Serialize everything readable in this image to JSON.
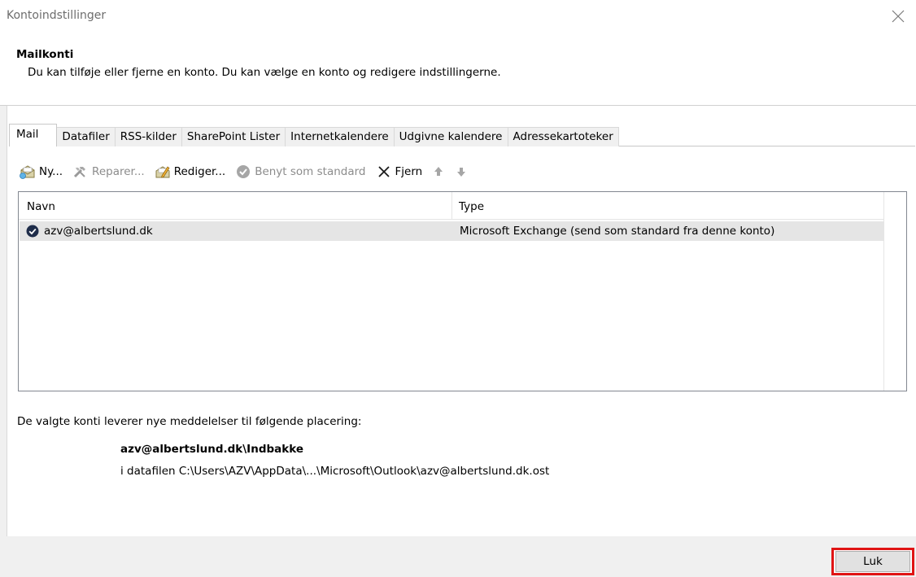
{
  "window": {
    "title": "Kontoindstillinger"
  },
  "header": {
    "title": "Mailkonti",
    "description": "Du kan tilføje eller fjerne en konto. Du kan vælge en konto og redigere indstillingerne."
  },
  "tabs": [
    {
      "label": "Mail",
      "active": true
    },
    {
      "label": "Datafiler"
    },
    {
      "label": "RSS-kilder"
    },
    {
      "label": "SharePoint Lister"
    },
    {
      "label": "Internetkalendere"
    },
    {
      "label": "Udgivne kalendere"
    },
    {
      "label": "Adressekartoteker"
    }
  ],
  "toolbar": {
    "new_label": "Ny...",
    "repair_label": "Reparer...",
    "edit_label": "Rediger...",
    "set_default_label": "Benyt som standard",
    "remove_label": "Fjern"
  },
  "accounts": {
    "columns": {
      "name": "Navn",
      "type": "Type"
    },
    "rows": [
      {
        "name": "azv@albertslund.dk",
        "type": "Microsoft Exchange (send som standard fra denne konto)"
      }
    ]
  },
  "delivery": {
    "label": "De valgte konti leverer nye meddelelser til følgende placering:",
    "folder_path": "azv@albertslund.dk\\Indbakke",
    "data_file": "i datafilen C:\\Users\\AZV\\AppData\\...\\Microsoft\\Outlook\\azv@albertslund.dk.ost"
  },
  "footer": {
    "close_label": "Luk"
  },
  "colors": {
    "highlight_border": "#e01414",
    "selected_row": "#e5e5e5"
  }
}
